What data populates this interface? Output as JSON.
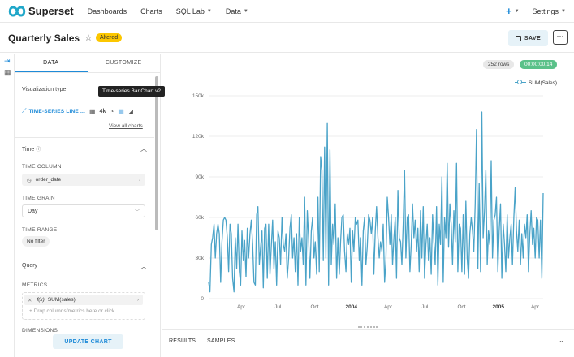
{
  "nav": {
    "brand": "Superset",
    "items": [
      {
        "label": "Dashboards",
        "dropdown": false
      },
      {
        "label": "Charts",
        "dropdown": false
      },
      {
        "label": "SQL Lab",
        "dropdown": true
      },
      {
        "label": "Data",
        "dropdown": true
      }
    ],
    "plus_label": "+",
    "settings_label": "Settings"
  },
  "header": {
    "title": "Quarterly Sales",
    "badge": "Altered",
    "save_label": "SAVE",
    "more_label": "···"
  },
  "panel": {
    "tabs": [
      {
        "label": "DATA",
        "active": true
      },
      {
        "label": "CUSTOMIZE",
        "active": false
      }
    ],
    "viz_type_label": "Visualization type",
    "viz_type_value": "TIME-SERIES LINE ...",
    "viz_extra": "4k",
    "view_all": "View all charts",
    "tooltip": "Time-series Bar Chart v2",
    "time_section": "Time",
    "time_column_label": "TIME COLUMN",
    "time_column_value": "order_date",
    "time_grain_label": "TIME GRAIN",
    "time_grain_value": "Day",
    "time_range_label": "TIME RANGE",
    "time_range_value": "No filter",
    "query_section": "Query",
    "metrics_label": "METRICS",
    "metric_value": "SUM(sales)",
    "metric_fx": "f(x)",
    "drop_hint": "Drop columns/metrics here or click",
    "dimensions_label": "DIMENSIONS",
    "update_label": "UPDATE CHART"
  },
  "main": {
    "rows": "252 rows",
    "time": "00:00:00.14",
    "results_tab": "RESULTS",
    "samples_tab": "SAMPLES"
  },
  "colors": {
    "accent": "#1f8bd8",
    "line": "#4aa3c8",
    "success": "#5ac189",
    "altered": "#fcc700"
  },
  "chart_data": {
    "type": "line",
    "series": [
      {
        "name": "SUM(Sales)",
        "values": [
          12000,
          5000,
          40000,
          45000,
          55000,
          30000,
          48000,
          55000,
          48000,
          12000,
          42000,
          58000,
          60000,
          58000,
          45000,
          20000,
          55000,
          48000,
          15000,
          5000,
          45000,
          22000,
          55000,
          20000,
          10000,
          50000,
          28000,
          43000,
          16000,
          52000,
          30000,
          48000,
          58000,
          40000,
          12000,
          10000,
          62000,
          68000,
          25000,
          38000,
          50000,
          8000,
          52000,
          55000,
          15000,
          55000,
          18000,
          38000,
          58000,
          22000,
          42000,
          10000,
          50000,
          45000,
          25000,
          60000,
          40000,
          35000,
          48000,
          15000,
          30000,
          52000,
          62000,
          30000,
          45000,
          20000,
          48000,
          10000,
          60000,
          35000,
          45000,
          25000,
          75000,
          10000,
          65000,
          45000,
          15000,
          50000,
          60000,
          30000,
          42000,
          18000,
          75000,
          20000,
          105000,
          95000,
          28000,
          112000,
          30000,
          130000,
          10000,
          110000,
          25000,
          55000,
          40000,
          70000,
          15000,
          45000,
          18000,
          42000,
          60000,
          62000,
          35000,
          20000,
          48000,
          40000,
          52000,
          12000,
          50000,
          35000,
          60000,
          55000,
          58000,
          28000,
          45000,
          10000,
          50000,
          60000,
          25000,
          38000,
          62000,
          58000,
          48000,
          60000,
          18000,
          50000,
          68000,
          45000,
          30000,
          42000,
          35000,
          55000,
          12000,
          28000,
          75000,
          60000,
          40000,
          62000,
          25000,
          45000,
          60000,
          15000,
          80000,
          45000,
          42000,
          25000,
          55000,
          95000,
          30000,
          60000,
          62000,
          20000,
          40000,
          70000,
          45000,
          58000,
          35000,
          52000,
          20000,
          65000,
          30000,
          68000,
          15000,
          40000,
          55000,
          28000,
          45000,
          18000,
          62000,
          42000,
          25000,
          68000,
          10000,
          55000,
          40000,
          90000,
          12000,
          60000,
          45000,
          100000,
          38000,
          70000,
          55000,
          25000,
          65000,
          42000,
          100000,
          20000,
          55000,
          52000,
          20000,
          62000,
          18000,
          72000,
          30000,
          15000,
          48000,
          60000,
          50000,
          35000,
          70000,
          125000,
          22000,
          85000,
          20000,
          138000,
          45000,
          65000,
          95000,
          25000,
          50000,
          40000,
          102000,
          30000,
          58000,
          62000,
          75000,
          20000,
          50000,
          70000,
          15000,
          55000,
          40000,
          20000,
          62000,
          30000,
          45000,
          55000,
          25000,
          60000,
          82000,
          50000,
          35000,
          58000,
          25000,
          48000,
          30000,
          55000,
          45000,
          62000,
          20000,
          48000,
          65000,
          40000,
          52000,
          30000,
          60000,
          58000,
          30000,
          58000,
          15000,
          78000
        ]
      }
    ],
    "x_ticks": [
      "Apr",
      "Jul",
      "Oct",
      "2004",
      "Apr",
      "Jul",
      "Oct",
      "2005",
      "Apr"
    ],
    "bold_ticks": [
      "2004",
      "2005"
    ],
    "y_ticks": [
      "0",
      "30k",
      "60k",
      "90k",
      "120k",
      "150k"
    ],
    "ylim": [
      0,
      150000
    ],
    "grid": true,
    "legend_position": "top-right"
  }
}
